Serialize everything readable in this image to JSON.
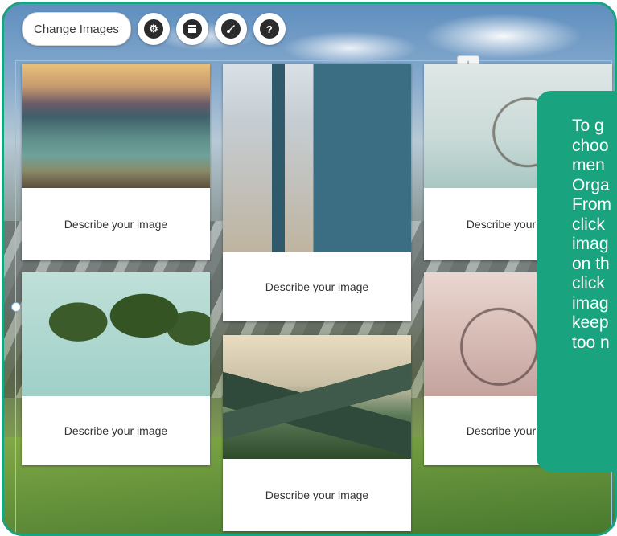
{
  "toolbar": {
    "change_images_label": "Change Images",
    "icons": [
      "gear-icon",
      "layout-icon",
      "brush-icon",
      "help-icon"
    ]
  },
  "download_icon": "download-icon",
  "cards": [
    {
      "caption": "Describe your image",
      "photo": "lake-mountains"
    },
    {
      "caption": "Describe your image",
      "photo": "palm-trees"
    },
    {
      "caption": "Describe your image",
      "photo": "beach-huts"
    },
    {
      "caption": "Describe your image",
      "photo": "green-hills"
    },
    {
      "caption": "Describe your image",
      "photo": "ferris-wheel"
    },
    {
      "caption": "Describe your image",
      "photo": "bicycle-wheel"
    }
  ],
  "tooltip": {
    "lines": [
      "To g",
      "choo",
      "men",
      "Orga",
      "From",
      "click",
      "imag",
      "on th",
      "click",
      "imag",
      "keep",
      "too n"
    ]
  },
  "colors": {
    "accent": "#19a37f",
    "selection": "#8ec5f0"
  }
}
